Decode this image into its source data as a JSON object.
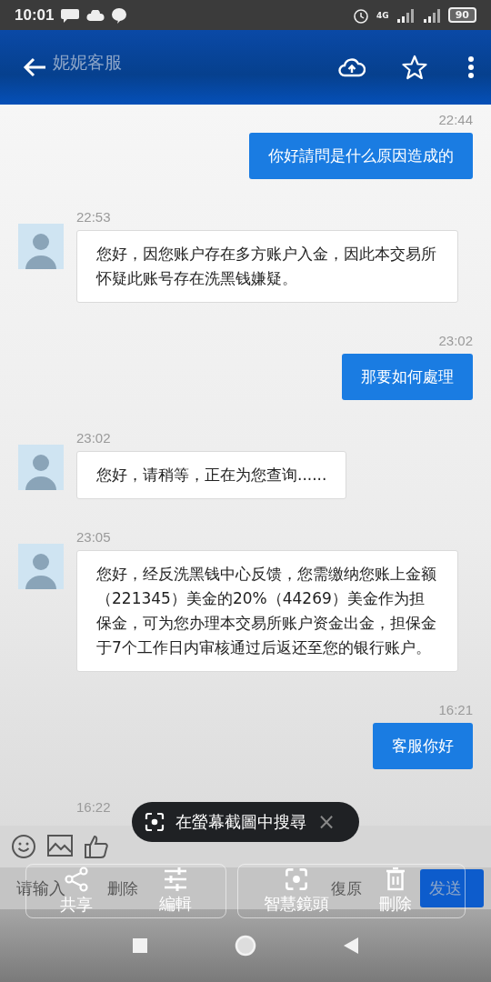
{
  "status_bar": {
    "time": "10:01",
    "battery": "90",
    "network": "4G"
  },
  "header": {
    "title": "妮妮客服"
  },
  "messages": [
    {
      "kind": "sent",
      "time": "22:44",
      "text": "你好請問是什么原因造成的"
    },
    {
      "kind": "received",
      "time": "22:53",
      "text": "您好，因您账户存在多方账户入金，因此本交易所怀疑此账号存在洗黑钱嫌疑。"
    },
    {
      "kind": "sent",
      "time": "23:02",
      "text": "那要如何處理"
    },
    {
      "kind": "received",
      "time": "23:02",
      "text": "您好，请稍等，正在为您查询......"
    },
    {
      "kind": "received",
      "time": "23:05",
      "text": "您好，经反洗黑钱中心反馈，您需缴纳您账上金额（221345）美金的20%（44269）美金作为担保金，可为您办理本交易所账户资金出金，担保金于7个工作日内审核通过后返还至您的银行账户。"
    },
    {
      "kind": "sent",
      "time": "16:21",
      "text": "客服你好"
    },
    {
      "kind": "time_only",
      "time": "16:22"
    }
  ],
  "composer": {
    "placeholder": "请输入",
    "buttons": [
      "删除",
      "復原"
    ],
    "send": "发送"
  },
  "screenshot_popup": {
    "label": "在螢幕截圖中搜尋",
    "close": "×"
  },
  "screenshot_actions": [
    {
      "kind": "share",
      "label": "共享"
    },
    {
      "kind": "edit",
      "label": "編輯"
    },
    {
      "kind": "lens",
      "label": "智慧鏡頭"
    },
    {
      "kind": "delete",
      "label": "刪除"
    }
  ]
}
